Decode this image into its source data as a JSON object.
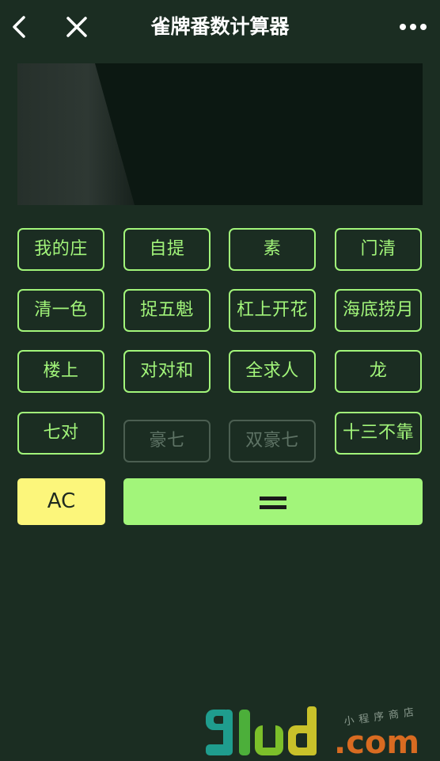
{
  "nav": {
    "title": "雀牌番数计算器"
  },
  "display": {
    "result": ""
  },
  "keys": [
    {
      "label": "我的庄",
      "enabled": true
    },
    {
      "label": "自提",
      "enabled": true
    },
    {
      "label": "素",
      "enabled": true
    },
    {
      "label": "门清",
      "enabled": true
    },
    {
      "label": "清一色",
      "enabled": true
    },
    {
      "label": "捉五魁",
      "enabled": true
    },
    {
      "label": "杠上开花",
      "enabled": true
    },
    {
      "label": "海底捞月",
      "enabled": true
    },
    {
      "label": "楼上",
      "enabled": true
    },
    {
      "label": "对对和",
      "enabled": true
    },
    {
      "label": "全求人",
      "enabled": true
    },
    {
      "label": "龙",
      "enabled": true
    },
    {
      "label": "七对",
      "enabled": true
    },
    {
      "label": "豪七",
      "enabled": false
    },
    {
      "label": "双豪七",
      "enabled": false
    },
    {
      "label": "十三不靠",
      "enabled": true
    }
  ],
  "actions": {
    "clear_label": "AC",
    "equals_icon": "equals-icon"
  },
  "watermark": {
    "logo": "91ud",
    "domain": ".com",
    "slogan": "小程序商店"
  },
  "colors": {
    "background": "#1b2d22",
    "accent": "#a2f57a",
    "clear": "#fcf67b",
    "disabled": "#4b5e51"
  }
}
